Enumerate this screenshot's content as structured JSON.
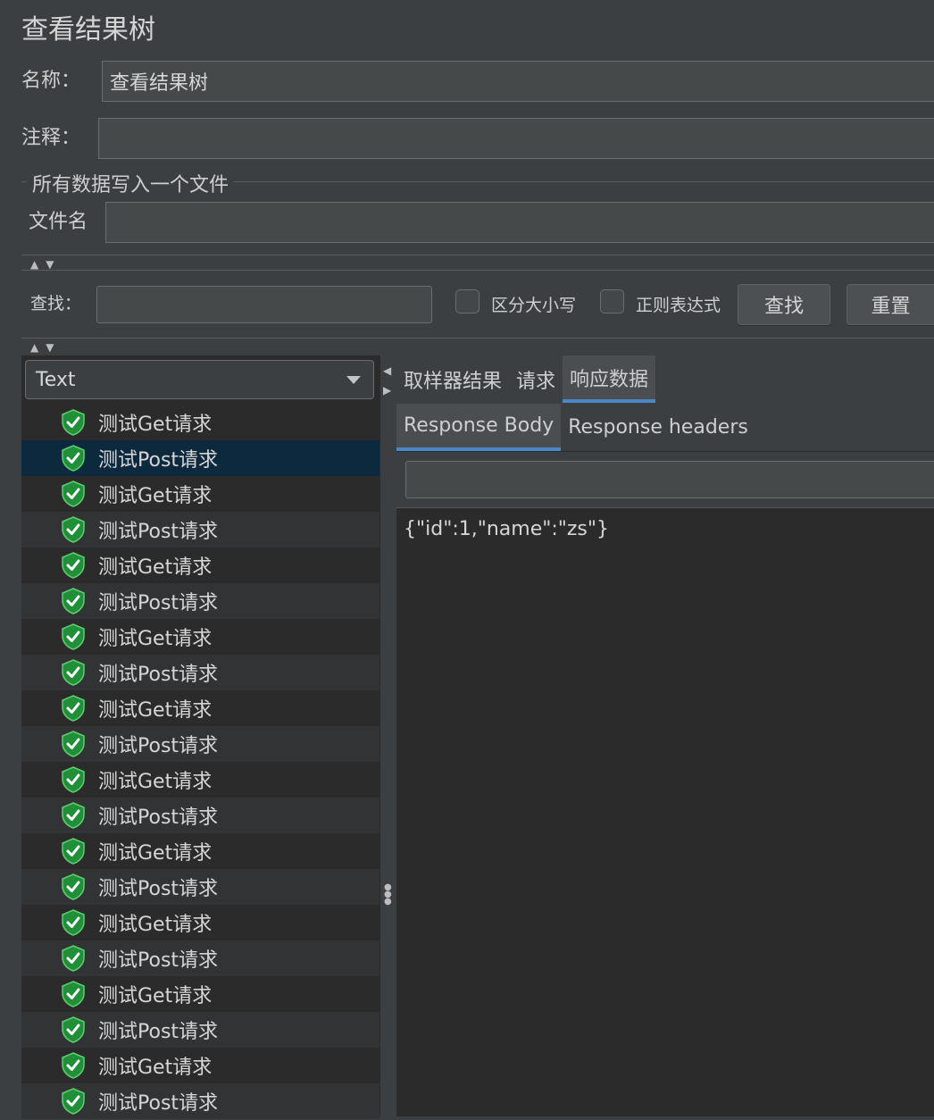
{
  "panel_title": "查看结果树",
  "name_label": "名称：",
  "name_value": "查看结果树",
  "comment_label": "注释：",
  "comment_value": "",
  "file_group_title": "所有数据写入一个文件",
  "filename_label": "文件名",
  "filename_value": "",
  "search": {
    "label": "查找：",
    "value": "",
    "case_sensitive_label": "区分大小写",
    "regex_label": "正则表达式",
    "find_button": "查找",
    "reset_button": "重置"
  },
  "renderer_select": {
    "selected": "Text"
  },
  "results_tree": [
    {
      "label": "测试Get请求",
      "selected": false
    },
    {
      "label": "测试Post请求",
      "selected": true
    },
    {
      "label": "测试Get请求",
      "selected": false
    },
    {
      "label": "测试Post请求",
      "selected": false
    },
    {
      "label": "测试Get请求",
      "selected": false
    },
    {
      "label": "测试Post请求",
      "selected": false
    },
    {
      "label": "测试Get请求",
      "selected": false
    },
    {
      "label": "测试Post请求",
      "selected": false
    },
    {
      "label": "测试Get请求",
      "selected": false
    },
    {
      "label": "测试Post请求",
      "selected": false
    },
    {
      "label": "测试Get请求",
      "selected": false
    },
    {
      "label": "测试Post请求",
      "selected": false
    },
    {
      "label": "测试Get请求",
      "selected": false
    },
    {
      "label": "测试Post请求",
      "selected": false
    },
    {
      "label": "测试Get请求",
      "selected": false
    },
    {
      "label": "测试Post请求",
      "selected": false
    },
    {
      "label": "测试Get请求",
      "selected": false
    },
    {
      "label": "测试Post请求",
      "selected": false
    },
    {
      "label": "测试Get请求",
      "selected": false
    },
    {
      "label": "测试Post请求",
      "selected": false
    }
  ],
  "tabs": [
    {
      "label": "取样器结果",
      "active": false
    },
    {
      "label": "请求",
      "active": false
    },
    {
      "label": "响应数据",
      "active": true
    }
  ],
  "subtabs": [
    {
      "label": "Response Body",
      "active": true
    },
    {
      "label": "Response headers",
      "active": false
    }
  ],
  "response_search_value": "",
  "response_body": "{\"id\":1,\"name\":\"zs\"}",
  "colors": {
    "background": "#3c3f41",
    "panel": "#2b2b2b",
    "selection": "#0d293e",
    "accent": "#4a88c7",
    "success_icon": "#2ea043"
  },
  "icons": {
    "tree_item": "success-shield-icon",
    "combo": "chevron-down-icon"
  }
}
